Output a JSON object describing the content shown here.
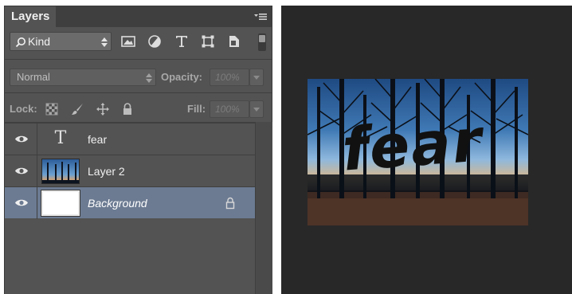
{
  "panel": {
    "tab_title": "Layers"
  },
  "filter": {
    "kind_label": "Kind"
  },
  "blend": {
    "mode": "Normal",
    "opacity_label": "Opacity:",
    "opacity_value": "100%"
  },
  "lock": {
    "label": "Lock:",
    "fill_label": "Fill:",
    "fill_value": "100%"
  },
  "layers": [
    {
      "name": "fear",
      "kind": "text",
      "selected": false
    },
    {
      "name": "Layer 2",
      "kind": "image",
      "selected": false
    },
    {
      "name": "Background",
      "kind": "background",
      "selected": true,
      "locked": true
    }
  ],
  "canvas": {
    "text": "fear"
  },
  "colors": {
    "panel_bg": "#535353",
    "selected_row": "#6c7b92",
    "workspace": "#282828"
  }
}
